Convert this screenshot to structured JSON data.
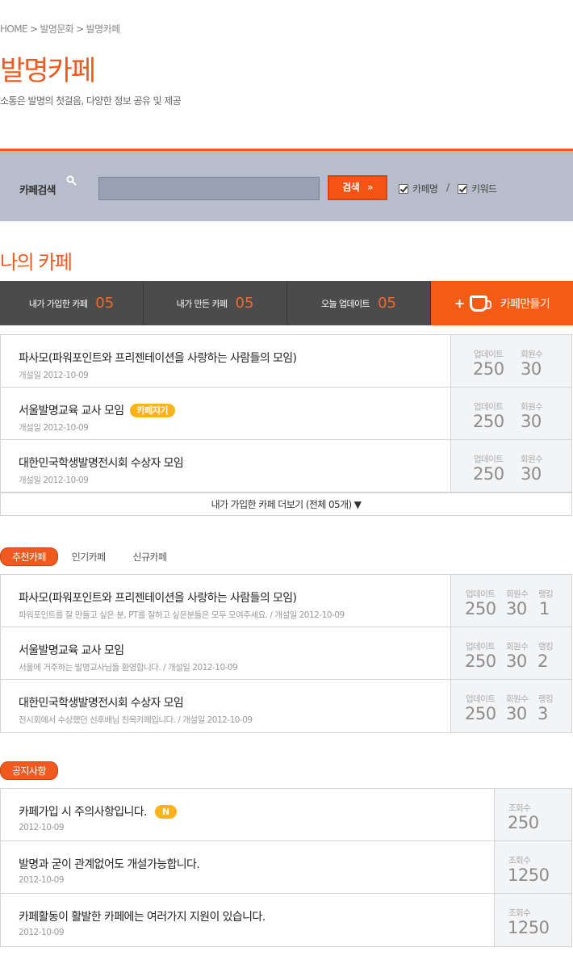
{
  "breadcrumb": [
    "HOME",
    "발명문화",
    "발명카페"
  ],
  "page": {
    "title": "발명카페",
    "subtitle": "소통은 발명의 첫걸음, 다양한 정보 공유 및 제공"
  },
  "search": {
    "label": "카페검색",
    "button": "검색",
    "button_arrow": "»",
    "opt_name": "카페명",
    "opt_keyword": "키워드",
    "slash": "/"
  },
  "my_cafe": {
    "title": "나의 카페",
    "stats": [
      {
        "label": "내가 가입한 카페",
        "num": "05"
      },
      {
        "label": "내가 만든 카페",
        "num": "05"
      },
      {
        "label": "오늘 업데이트",
        "num": "05"
      }
    ],
    "make_button": "카페만들기",
    "make_plus": "+",
    "col_update": "업데이트",
    "col_members": "회원수",
    "items": [
      {
        "name": "파사모(파워포인트와 프리젠테이션을 사랑하는 사람들의 모임)",
        "date": "개설일 2012-10-09",
        "update": "250",
        "members": "30",
        "tag": ""
      },
      {
        "name": "서울발명교육 교사 모임",
        "date": "개설일 2012-10-09",
        "update": "250",
        "members": "30",
        "tag": "카페지기"
      },
      {
        "name": "대한민국학생발명전시회 수상자 모임",
        "date": "개설일 2012-10-09",
        "update": "250",
        "members": "30",
        "tag": ""
      }
    ],
    "more": "내가 가입한 카페 더보기 (전체 05개) ▼"
  },
  "recommend": {
    "tabs": [
      "추천카페",
      "인기카페",
      "신규카페"
    ],
    "col_update": "업데이트",
    "col_members": "회원수",
    "col_rank": "랭킹",
    "items": [
      {
        "name": "파사모(파워포인트와 프리젠테이션을 사랑하는 사람들의 모임)",
        "desc": "파워포인트를 잘 만들고 싶은 분, PT를 잘하고 싶은분들은 모두 모여주세요.  / 개설일 2012-10-09",
        "update": "250",
        "members": "30",
        "rank": "1"
      },
      {
        "name": "서울발명교육 교사 모임",
        "desc": "서울에 거주하는 발명교사님들 환영합니다. / 개설일 2012-10-09",
        "update": "250",
        "members": "30",
        "rank": "2"
      },
      {
        "name": "대한민국학생발명전시회 수상자 모임",
        "desc": "전시회에서 수상했던 선후배님 친목카페입니다. / 개설일 2012-10-09",
        "update": "250",
        "members": "30",
        "rank": "3"
      }
    ]
  },
  "notice": {
    "tab": "공지사항",
    "col_views": "조회수",
    "items": [
      {
        "title": "카페가입 시 주의사항입니다.",
        "date": "2012-10-09",
        "views": "250",
        "badge": "N"
      },
      {
        "title": "발명과 굳이 관계없어도 개설가능합니다.",
        "date": "2012-10-09",
        "views": "1250",
        "badge": ""
      },
      {
        "title": "카페활동이 활발한 카페에는 여러가지 지원이 있습니다.",
        "date": "2012-10-09",
        "views": "1250",
        "badge": ""
      }
    ]
  },
  "colors": {
    "accent": "#f05a1e",
    "search_bg": "#b7bdcb",
    "tag": "#fbb318"
  }
}
